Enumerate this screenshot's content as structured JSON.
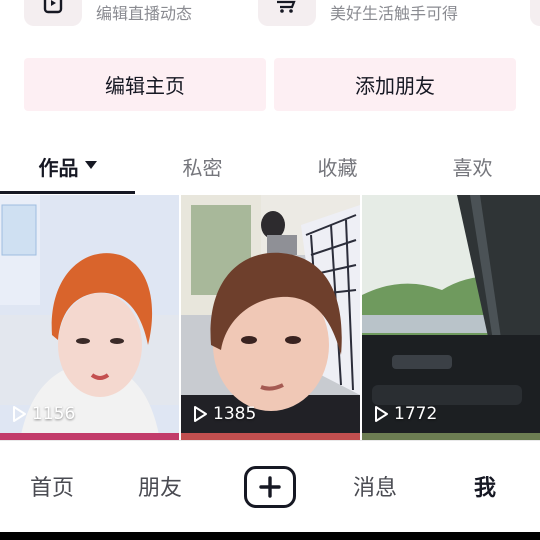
{
  "features": {
    "left": {
      "icon": "play-square-icon",
      "text": "编辑直播动态"
    },
    "right": {
      "icon": "shopping-cart-icon",
      "text": "美好生活触手可得"
    }
  },
  "profile_buttons": {
    "edit_profile": "编辑主页",
    "add_friends": "添加朋友"
  },
  "tabs": [
    {
      "label": "作品",
      "active": true
    },
    {
      "label": "私密",
      "active": false
    },
    {
      "label": "收藏",
      "active": false
    },
    {
      "label": "喜欢",
      "active": false
    }
  ],
  "videos": [
    {
      "plays": "1156"
    },
    {
      "plays": "1385"
    },
    {
      "plays": "1772"
    }
  ],
  "bottom_nav": {
    "home": "首页",
    "friends": "朋友",
    "create_icon": "plus-icon",
    "messages": "消息",
    "me": "我"
  },
  "colors": {
    "button_bg": "#fdeff3",
    "text_primary": "#161823",
    "text_secondary": "#8a8b91"
  }
}
